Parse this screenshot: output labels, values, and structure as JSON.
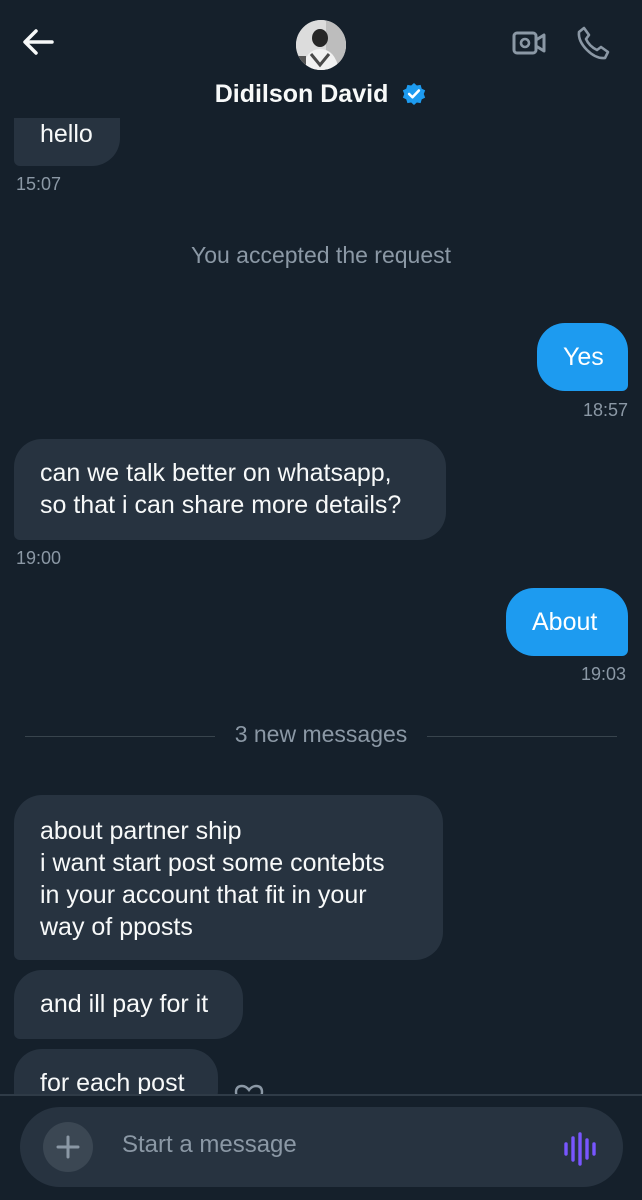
{
  "header": {
    "title": "Didilson David",
    "back_icon": "arrow-left-icon",
    "video_icon": "video-call-icon",
    "phone_icon": "phone-call-icon",
    "verified_icon": "verified-badge-icon",
    "accent": "#1d9bf0"
  },
  "messages": {
    "m1": {
      "text": "hello",
      "time": "15:07"
    },
    "system": "You accepted the request",
    "m2": {
      "text": "Yes",
      "time": "18:57"
    },
    "m3": {
      "lines": [
        "can we talk better on whatsapp,",
        "so that i can share more details?"
      ],
      "time": "19:00"
    },
    "m4": {
      "text": "About",
      "time": "19:03"
    },
    "divider": "3 new messages",
    "m5": {
      "lines": [
        "about partner ship",
        "i want start post some contebts",
        "in your account that fit in your",
        "way of pposts"
      ]
    },
    "m6": {
      "text": "and ill pay for it"
    },
    "m7": {
      "text": "for each post"
    }
  },
  "composer": {
    "placeholder": "Start a message",
    "plus_icon": "plus-icon",
    "voice_icon": "voice-message-icon"
  },
  "colors": {
    "background": "#15202b",
    "incoming_bubble": "#273340",
    "outgoing_bubble": "#1d9bf0",
    "muted_text": "#8b98a5",
    "voice_icon": "#7856ff"
  }
}
